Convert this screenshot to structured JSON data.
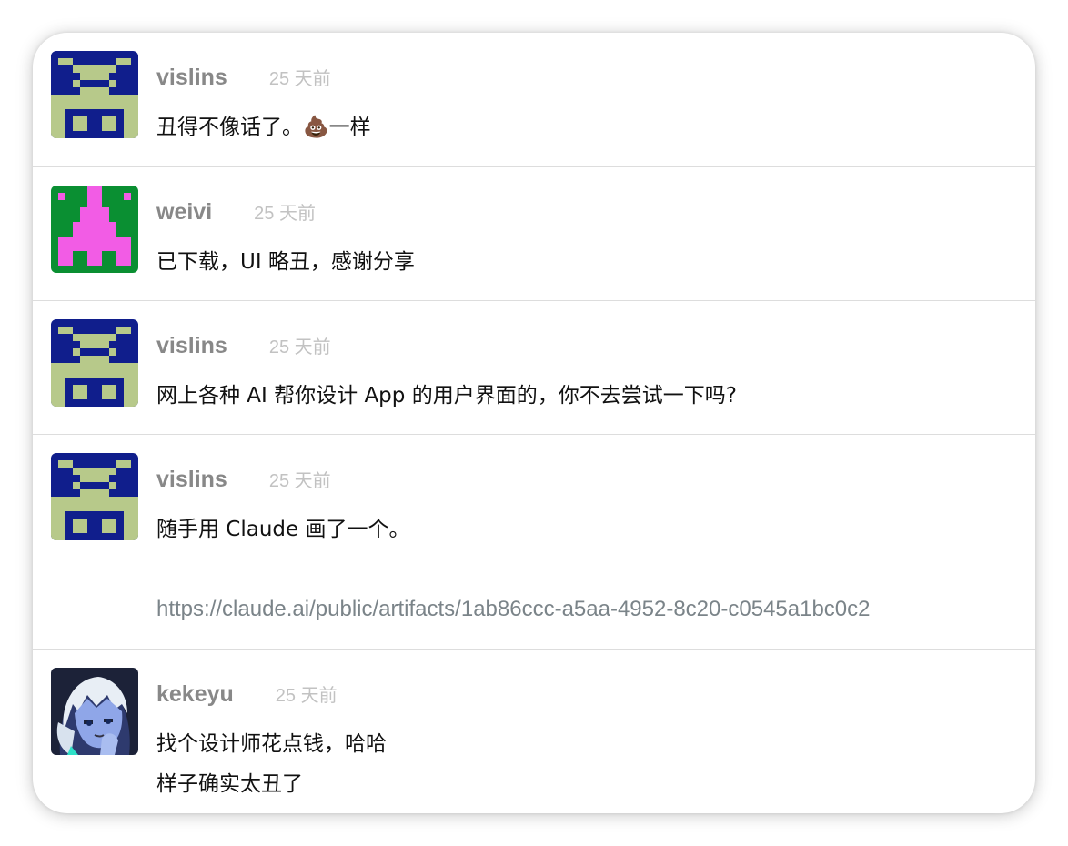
{
  "comments": [
    {
      "username": "vislins",
      "time": "25 天前",
      "lines": [
        "丑得不像话了。💩一样"
      ]
    },
    {
      "username": "weivi",
      "time": "25 天前",
      "lines": [
        "已下载，UI 略丑，感谢分享"
      ]
    },
    {
      "username": "vislins",
      "time": "25 天前",
      "lines": [
        "网上各种 AI 帮你设计 App 的用户界面的，你不去尝试一下吗?"
      ]
    },
    {
      "username": "vislins",
      "time": "25 天前",
      "lines": [
        "随手用 Claude 画了一个。"
      ],
      "link": "https://claude.ai/public/artifacts/1ab86ccc-a5aa-4952-8c20-c0545a1bc0c2"
    },
    {
      "username": "kekeyu",
      "time": "25 天前",
      "lines": [
        "找个设计师花点钱，哈哈",
        "样子确实太丑了"
      ]
    }
  ],
  "colors": {
    "invader_blue_bg": "#101e8c",
    "invader_blue_fg": "#b7c98a",
    "invader_green_bg": "#0a8f32",
    "invader_green_fg": "#f25ce5",
    "anime_bg": "#1c2238"
  },
  "icons": {
    "avatar_vislins": "space-invader-avatar-icon",
    "avatar_weivi": "space-invader-avatar-icon",
    "avatar_kekeyu": "anime-character-avatar-icon"
  }
}
